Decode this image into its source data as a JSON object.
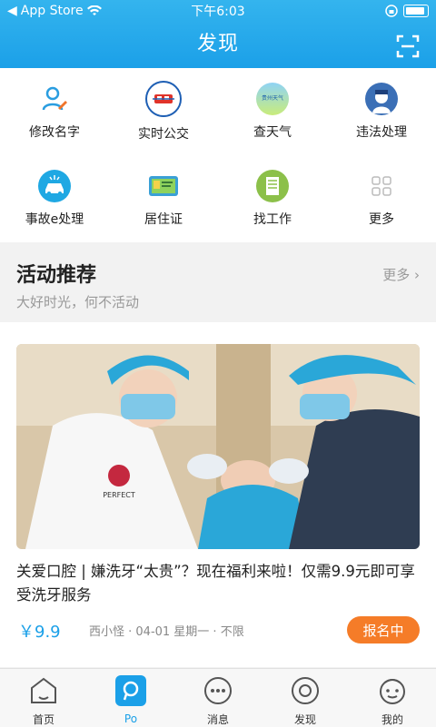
{
  "status": {
    "carrier": "App Store",
    "time": "下午6:03"
  },
  "header": {
    "title": "发现"
  },
  "services": [
    {
      "label": "修改名字",
      "icon": "edit-name-icon"
    },
    {
      "label": "实时公交",
      "icon": "bus-icon"
    },
    {
      "label": "查天气",
      "icon": "weather-icon"
    },
    {
      "label": "违法处理",
      "icon": "police-icon"
    },
    {
      "label": "事故e处理",
      "icon": "accident-icon"
    },
    {
      "label": "居住证",
      "icon": "residence-card-icon"
    },
    {
      "label": "找工作",
      "icon": "job-icon"
    },
    {
      "label": "更多",
      "icon": "grid-icon"
    }
  ],
  "weather_icon_text": "贵州天气",
  "activity": {
    "title": "活动推荐",
    "subtitle": "大好时光，何不活动",
    "more": "更多"
  },
  "card": {
    "title": "关爱口腔 | 嫌洗牙“太贵”？现在福利来啦！仅需9.9元即可享受洗牙服务",
    "price": "￥9.9",
    "meta": "西小怪 · 04-01 星期一 · 不限",
    "signup": "报名中",
    "photo_badge": "PERFECT"
  },
  "tabs": [
    {
      "label": "首页",
      "icon": "home-icon",
      "active": false
    },
    {
      "label": "Po",
      "icon": "po-icon",
      "active": true
    },
    {
      "label": "消息",
      "icon": "message-icon",
      "active": false
    },
    {
      "label": "发现",
      "icon": "discover-icon",
      "active": false
    },
    {
      "label": "我的",
      "icon": "profile-icon",
      "active": false
    }
  ],
  "colors": {
    "primary": "#1ba0e8",
    "accent": "#f57c28"
  }
}
